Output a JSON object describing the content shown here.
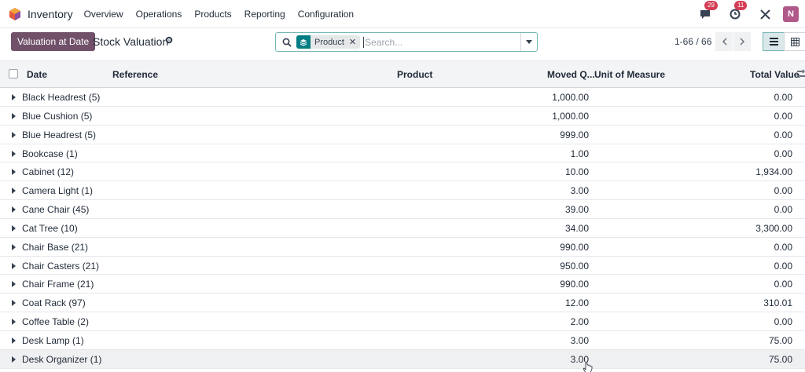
{
  "app": {
    "name": "Inventory",
    "menu": [
      "Overview",
      "Operations",
      "Products",
      "Reporting",
      "Configuration"
    ],
    "messages_badge": "29",
    "activities_badge": "11",
    "avatar_letter": "N",
    "colors": {
      "primary": "#71516a",
      "accent": "#017e84",
      "badge": "#d43d54",
      "avatar": "#b0588a"
    }
  },
  "control": {
    "valuation_button": "Valuation at Date",
    "title": "Stock Valuation",
    "facet_label": "Product",
    "search_placeholder": "Search...",
    "pager": "1-66 / 66"
  },
  "table": {
    "headers": {
      "date": "Date",
      "reference": "Reference",
      "product": "Product",
      "moved_qty": "Moved Q...",
      "uom": "Unit of Measure",
      "total_value": "Total Value"
    },
    "groups": [
      {
        "name": "Black Headrest (5)",
        "moved": "1,000.00",
        "total": "0.00"
      },
      {
        "name": "Blue Cushion (5)",
        "moved": "1,000.00",
        "total": "0.00"
      },
      {
        "name": "Blue Headrest (5)",
        "moved": "999.00",
        "total": "0.00"
      },
      {
        "name": "Bookcase (1)",
        "moved": "1.00",
        "total": "0.00"
      },
      {
        "name": "Cabinet (12)",
        "moved": "10.00",
        "total": "1,934.00"
      },
      {
        "name": "Camera Light (1)",
        "moved": "3.00",
        "total": "0.00"
      },
      {
        "name": "Cane Chair (45)",
        "moved": "39.00",
        "total": "0.00"
      },
      {
        "name": "Cat Tree (10)",
        "moved": "34.00",
        "total": "3,300.00"
      },
      {
        "name": "Chair Base (21)",
        "moved": "990.00",
        "total": "0.00"
      },
      {
        "name": "Chair Casters (21)",
        "moved": "950.00",
        "total": "0.00"
      },
      {
        "name": "Chair Frame (21)",
        "moved": "990.00",
        "total": "0.00"
      },
      {
        "name": "Coat Rack (97)",
        "moved": "12.00",
        "total": "310.01"
      },
      {
        "name": "Coffee Table (2)",
        "moved": "2.00",
        "total": "0.00"
      },
      {
        "name": "Desk Lamp (1)",
        "moved": "3.00",
        "total": "75.00"
      },
      {
        "name": "Desk Organizer (1)",
        "moved": "3.00",
        "total": "75.00"
      }
    ]
  }
}
